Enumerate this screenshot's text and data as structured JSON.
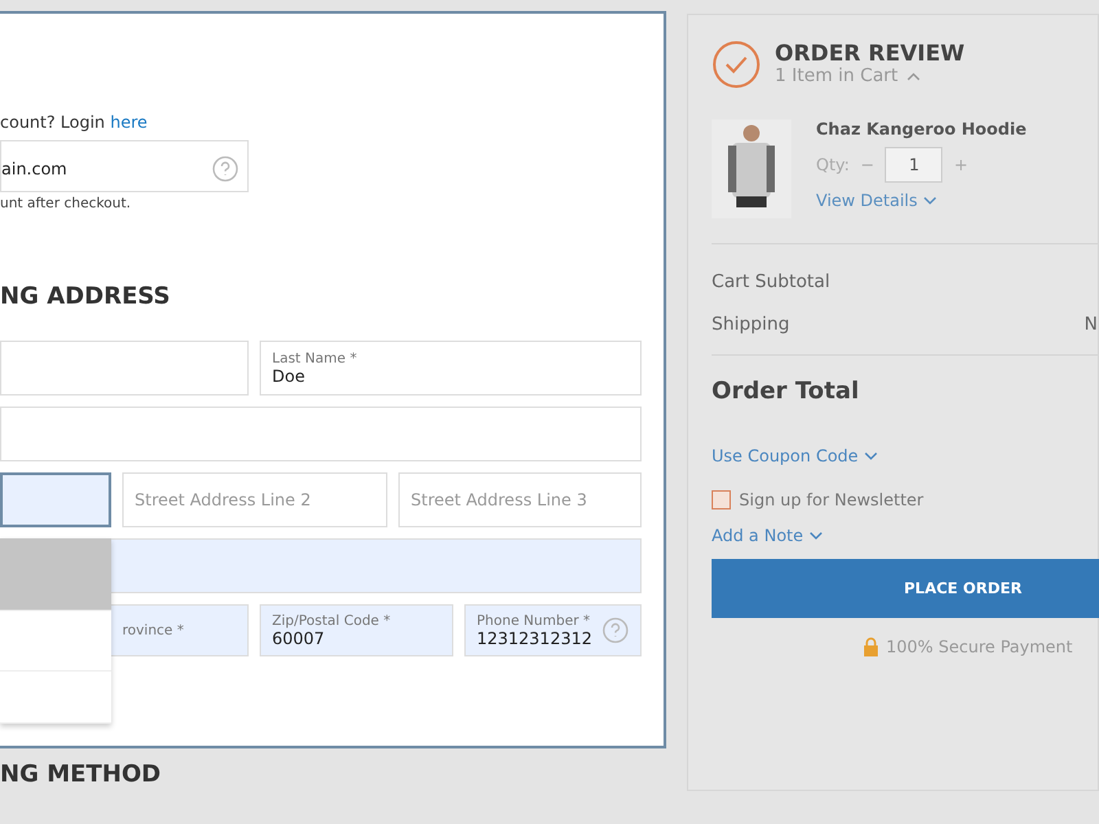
{
  "login_prompt": {
    "text": "count? Login",
    "link": "here"
  },
  "email": {
    "value": "ain.com",
    "help": true,
    "hint": "unt after checkout."
  },
  "shipping_heading": "NG ADDRESS",
  "address_rows": [
    [
      {
        "focused": false,
        "autofilled": false,
        "help": false
      },
      {
        "label": "Last Name *",
        "value": "Doe",
        "focused": false,
        "autofilled": false,
        "help": false
      }
    ],
    [
      {
        "focused": false,
        "autofilled": false,
        "help": false
      }
    ],
    [
      {
        "focused": true,
        "autofilled": true,
        "help": false
      },
      {
        "placeholder": "Street Address Line 2",
        "focused": false,
        "autofilled": false,
        "help": false
      },
      {
        "placeholder": "Street Address Line 3",
        "focused": false,
        "autofilled": false,
        "help": false
      }
    ],
    [
      {
        "focused": false,
        "autofilled": true,
        "help": false
      }
    ],
    [
      {
        "label": "rovince *",
        "focused": false,
        "autofilled": true,
        "help": false
      },
      {
        "label": "Zip/Postal Code *",
        "value": "60007",
        "focused": false,
        "autofilled": true,
        "help": false
      },
      {
        "label": "Phone Number *",
        "value": "12312312312",
        "focused": false,
        "autofilled": true,
        "help": true
      }
    ]
  ],
  "autocomplete": {
    "options": [
      {
        "selected": true
      },
      {
        "selected": false
      },
      {
        "selected": false
      }
    ]
  },
  "next_heading": "NG METHOD",
  "order_review": {
    "title": "ORDER REVIEW",
    "count": "1 Item in Cart",
    "expanded": true,
    "items": [
      {
        "name": "Chaz Kangeroo Hoodie",
        "qty_label": "Qty:",
        "minus": "−",
        "qty": "1",
        "plus": "+",
        "details": "View Details"
      }
    ],
    "subtotal_label": "Cart Subtotal",
    "shipping_label": "Shipping",
    "shipping_value": "N",
    "total_label": "Order Total",
    "coupon": "Use Coupon Code",
    "newsletter": {
      "label": "Sign up for Newsletter",
      "checked": false
    },
    "note": "Add a Note",
    "button": "PLACE ORDER",
    "secure": "100% Secure Payment"
  }
}
